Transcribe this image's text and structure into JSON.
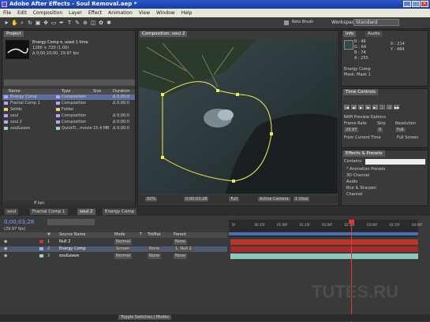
{
  "window": {
    "title": "Adobe After Effects - Soul Removal.aep *",
    "controls": [
      "_",
      "□",
      "×"
    ]
  },
  "menu": [
    "File",
    "Edit",
    "Composition",
    "Layer",
    "Effect",
    "Animation",
    "View",
    "Window",
    "Help"
  ],
  "toolbar": {
    "workspace_label": "Workspace:",
    "workspace_value": "Standard",
    "roto_label": "Roto Brush"
  },
  "project": {
    "tab": "Project",
    "comp_name": "Energy Comp ▾, used 1 time",
    "comp_info1": "1280 × 720 (1.00)",
    "comp_info2": "Δ 0;00;10;00, 29.97 fps",
    "columns": [
      "Name",
      "Type",
      "Size",
      "Duration"
    ],
    "items": [
      {
        "name": "Energy Comp",
        "type": "Composition",
        "size": "",
        "duration": "Δ 0;00;0",
        "color": "#b4a3ff",
        "selected": true
      },
      {
        "name": "Fractal Comp 1",
        "type": "Composition",
        "size": "",
        "duration": "Δ 0;00;0",
        "color": "#b4a3ff",
        "selected": false
      },
      {
        "name": "Solids",
        "type": "Folder",
        "size": "",
        "duration": "",
        "color": "#e8d26b",
        "selected": false
      },
      {
        "name": "soul",
        "type": "Composition",
        "size": "",
        "duration": "Δ 0;00;0",
        "color": "#b4a3ff",
        "selected": false
      },
      {
        "name": "soul 2",
        "type": "Composition",
        "size": "",
        "duration": "Δ 0;00;0",
        "color": "#b4a3ff",
        "selected": false
      },
      {
        "name": "soulLeave",
        "type": "QuickTi...movie",
        "size": "15.4 MB",
        "duration": "Δ 0;00;0",
        "color": "#9fd3c7",
        "selected": false
      }
    ],
    "footer_bpc": "8 bpc"
  },
  "composition": {
    "tab": "Composition: soul 2",
    "footer": [
      "50%",
      "0;00;03;28",
      "Full",
      "Active Camera",
      "1 View"
    ]
  },
  "info": {
    "tabs": [
      "Info",
      "Audio"
    ],
    "values": [
      "R : 46",
      "G : 64",
      "B : 74",
      "A : 255"
    ],
    "xy": [
      "X : 214",
      "Y : 484"
    ],
    "layer": "Energy Comp",
    "mask": "Mask: Mask 1"
  },
  "time_controls": {
    "tab": "Time Controls",
    "ram_preview": "RAM Preview Options",
    "frame_rate_label": "Frame Rate",
    "skip_label": "Skip",
    "resolution_label": "Resolution",
    "frame_rate": "29.97",
    "skip": "0",
    "resolution": "Full",
    "from_current": "From Current Time",
    "full_screen": "Full Screen"
  },
  "effects": {
    "tab": "Effects & Presets",
    "contains_label": "Contains:",
    "items": [
      "* Animation Presets",
      "3D Channel",
      "Audio",
      "Blur & Sharpen",
      "Channel"
    ]
  },
  "timeline": {
    "tabs": [
      "soul",
      "Fractal Comp 1",
      "soul 2",
      "Energy Comp"
    ],
    "timecode": "0;00;03;28",
    "fps_note": "(29.97 fps)",
    "columns": [
      "#",
      "Source Name",
      "Mode",
      "T",
      "TrkMat",
      "Parent"
    ],
    "layers": [
      {
        "num": "1",
        "name": "Null 2",
        "mode": "Normal",
        "trkmat": "",
        "parent": "None",
        "label_color": "#c43a3a",
        "bar_color": "#b8352c"
      },
      {
        "num": "2",
        "name": "Energy Comp",
        "mode": "Screen",
        "trkmat": "None",
        "parent": "1. Null 2",
        "label_color": "#b4a3ff",
        "bar_color": "#a82a24",
        "selected": true
      },
      {
        "num": "3",
        "name": "soulLeave",
        "mode": "Normal",
        "trkmat": "None",
        "parent": "None",
        "label_color": "#9fd3c7",
        "bar_color": "#8cc8bf"
      }
    ],
    "ruler": [
      "0f",
      "00:15f",
      "01:00f",
      "01:15f",
      "02:00f",
      "02:15f",
      "03:00f",
      "03:15f",
      "04:00f"
    ],
    "toggle_label": "Toggle Switches / Modes",
    "watermark": "TUTES.RU"
  }
}
